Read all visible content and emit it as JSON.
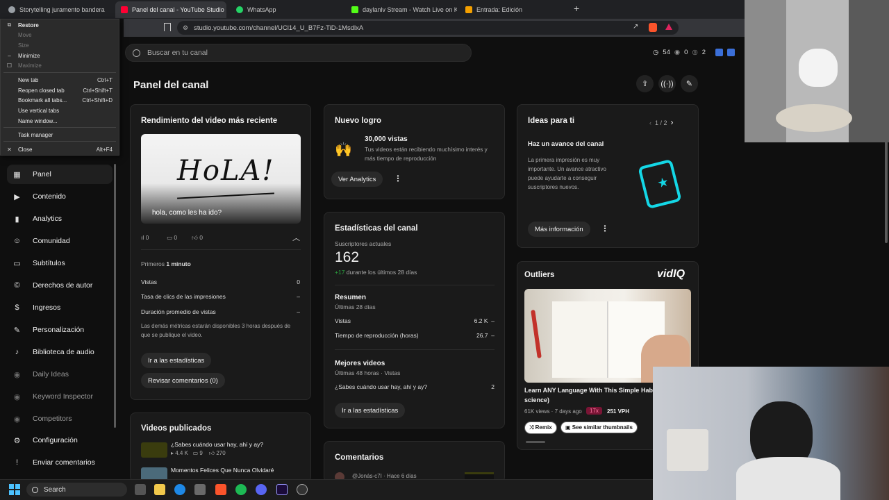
{
  "browser": {
    "tabs": [
      {
        "title": "Storytelling juramento bandera",
        "color": "#9aa0a6"
      },
      {
        "title": "Panel del canal - YouTube Studio",
        "color": "#ff0033"
      },
      {
        "title": "WhatsApp",
        "color": "#25d366"
      },
      {
        "title": "daylanlv Stream - Watch Live on Kick",
        "color": "#53fc18"
      },
      {
        "title": "Entrada: Edición",
        "color": "#f4a000"
      }
    ],
    "url": "studio.youtube.com/channel/UCl14_U_B7Fz-TiD-1MsdlxA"
  },
  "context_menu": {
    "items": [
      {
        "label": "Restore",
        "icon": "restore-icon",
        "glyph": "⧉",
        "shortcut": "",
        "disabled": false,
        "bold": true
      },
      {
        "label": "Move",
        "icon": "",
        "glyph": "",
        "shortcut": "",
        "disabled": true,
        "bold": false
      },
      {
        "label": "Size",
        "icon": "",
        "glyph": "",
        "shortcut": "",
        "disabled": true,
        "bold": false
      },
      {
        "label": "Minimize",
        "icon": "minimize-icon",
        "glyph": "–",
        "shortcut": "",
        "disabled": false,
        "bold": false
      },
      {
        "label": "Maximize",
        "icon": "maximize-icon",
        "glyph": "☐",
        "shortcut": "",
        "disabled": true,
        "bold": false
      },
      {
        "label": "New tab",
        "icon": "",
        "glyph": "",
        "shortcut": "Ctrl+T",
        "disabled": false,
        "bold": false
      },
      {
        "label": "Reopen closed tab",
        "icon": "",
        "glyph": "",
        "shortcut": "Ctrl+Shift+T",
        "disabled": false,
        "bold": false
      },
      {
        "label": "Bookmark all tabs...",
        "icon": "",
        "glyph": "",
        "shortcut": "Ctrl+Shift+D",
        "disabled": false,
        "bold": false
      },
      {
        "label": "Use vertical tabs",
        "icon": "",
        "glyph": "",
        "shortcut": "",
        "disabled": false,
        "bold": false
      },
      {
        "label": "Name window...",
        "icon": "",
        "glyph": "",
        "shortcut": "",
        "disabled": false,
        "bold": false
      },
      {
        "label": "Task manager",
        "icon": "",
        "glyph": "",
        "shortcut": "",
        "disabled": false,
        "bold": false
      },
      {
        "label": "Close",
        "icon": "close-icon",
        "glyph": "✕",
        "shortcut": "Alt+F4",
        "disabled": false,
        "bold": false
      }
    ]
  },
  "search": {
    "placeholder": "Buscar en tu canal"
  },
  "top_stats": {
    "views": "54",
    "comments": "0",
    "live": "2"
  },
  "page": {
    "title": "Panel del canal"
  },
  "sidebar": {
    "items": [
      {
        "label": "Panel",
        "icon": "dashboard-icon",
        "glyph": "▦",
        "active": true,
        "dim": false
      },
      {
        "label": "Contenido",
        "icon": "content-icon",
        "glyph": "▶",
        "active": false,
        "dim": false
      },
      {
        "label": "Analytics",
        "icon": "analytics-icon",
        "glyph": "▮",
        "active": false,
        "dim": false
      },
      {
        "label": "Comunidad",
        "icon": "community-icon",
        "glyph": "☺",
        "active": false,
        "dim": false
      },
      {
        "label": "Subtítulos",
        "icon": "subtitles-icon",
        "glyph": "▭",
        "active": false,
        "dim": false
      },
      {
        "label": "Derechos de autor",
        "icon": "copyright-icon",
        "glyph": "©",
        "active": false,
        "dim": false
      },
      {
        "label": "Ingresos",
        "icon": "earn-icon",
        "glyph": "$",
        "active": false,
        "dim": false
      },
      {
        "label": "Personalización",
        "icon": "customization-icon",
        "glyph": "✎",
        "active": false,
        "dim": false
      },
      {
        "label": "Biblioteca de audio",
        "icon": "audio-library-icon",
        "glyph": "♪",
        "active": false,
        "dim": false
      },
      {
        "label": "Daily Ideas",
        "icon": "vidiq-icon",
        "glyph": "◉",
        "active": false,
        "dim": true
      },
      {
        "label": "Keyword Inspector",
        "icon": "vidiq-icon",
        "glyph": "◉",
        "active": false,
        "dim": true
      },
      {
        "label": "Competitors",
        "icon": "vidiq-icon",
        "glyph": "◉",
        "active": false,
        "dim": true
      },
      {
        "label": "Configuración",
        "icon": "settings-icon",
        "glyph": "⚙",
        "active": false,
        "dim": false
      },
      {
        "label": "Enviar comentarios",
        "icon": "feedback-icon",
        "glyph": "!",
        "active": false,
        "dim": false
      }
    ]
  },
  "latest_video": {
    "title": "Rendimiento del video más reciente",
    "thumb_text": "HoLA!",
    "caption": "hola, como les ha ido?",
    "views": "0",
    "comments": "0",
    "likes": "0",
    "first_label": "Primeros",
    "first_value": "1 minuto",
    "metrics": [
      {
        "label": "Vistas",
        "value": "0"
      },
      {
        "label": "Tasa de clics de las impresiones",
        "value": "–"
      },
      {
        "label": "Duración promedio de vistas",
        "value": "–"
      }
    ],
    "note_line1": "Las demás métricas estarán disponibles 3 horas después de",
    "note_line2": "que se publique el video.",
    "btn_stats": "Ir a las estadísticas",
    "btn_comments": "Revisar comentarios (0)"
  },
  "published": {
    "title": "Videos publicados",
    "videos": [
      {
        "title": "¿Sabes cuándo usar hay, ahí y ay?",
        "views": "4.4 K",
        "comments": "9",
        "likes": "270"
      },
      {
        "title": "Momentos Felices Que Nunca Olvidaré",
        "views": "",
        "comments": "",
        "likes": ""
      }
    ]
  },
  "achievement": {
    "title": "Nuevo logro",
    "headline": "30,000 vistas",
    "desc_line1": "Tus videos están recibiendo muchísimo interés y",
    "desc_line2": "más tiempo de reproducción",
    "btn": "Ver Analytics"
  },
  "channel_stats": {
    "title": "Estadísticas del canal",
    "subs_label": "Suscriptores actuales",
    "subs": "162",
    "delta": "+17",
    "delta_suffix": "durante los últimos 28 días",
    "summary_title": "Resumen",
    "summary_range": "Últimas 28 días",
    "summary": [
      {
        "label": "Vistas",
        "value": "6.2 K",
        "trend": "–"
      },
      {
        "label": "Tiempo de reproducción (horas)",
        "value": "26.7",
        "trend": "–"
      }
    ],
    "top_title": "Mejores videos",
    "top_range": "Últimas 48 horas · Vistas",
    "top_videos": [
      {
        "title": "¿Sabes cuándo usar hay, ahí y ay?",
        "value": "2"
      }
    ],
    "btn": "Ir a las estadísticas"
  },
  "comments": {
    "title": "Comentarios",
    "author": "@Jonás-c7I",
    "time": "· Hace 6 días"
  },
  "ideas": {
    "title": "Ideas para ti",
    "pager": "1 / 2",
    "headline": "Haz un avance del canal",
    "body": [
      "La primera impresión es muy",
      "importante. Un avance atractivo",
      "puede ayudarte a conseguir",
      "suscriptores nuevos."
    ],
    "btn": "Más información"
  },
  "outliers": {
    "title": "Outliers",
    "brand": "vidIQ",
    "video_title_1": "Learn ANY Language With This Simple Habi",
    "video_title_2": "science)",
    "meta": "61K views · 7 days ago",
    "multiplier": "17x",
    "vph": "251 VPH",
    "btn_remix": "Remix",
    "btn_similar": "See similar thumbnails"
  },
  "taskbar": {
    "search": "Search"
  },
  "colors": {
    "bg": "#0f0f0f",
    "card": "#1a1a1a",
    "accent_green": "#2ba640",
    "vidiq_red": "#e0245e"
  }
}
